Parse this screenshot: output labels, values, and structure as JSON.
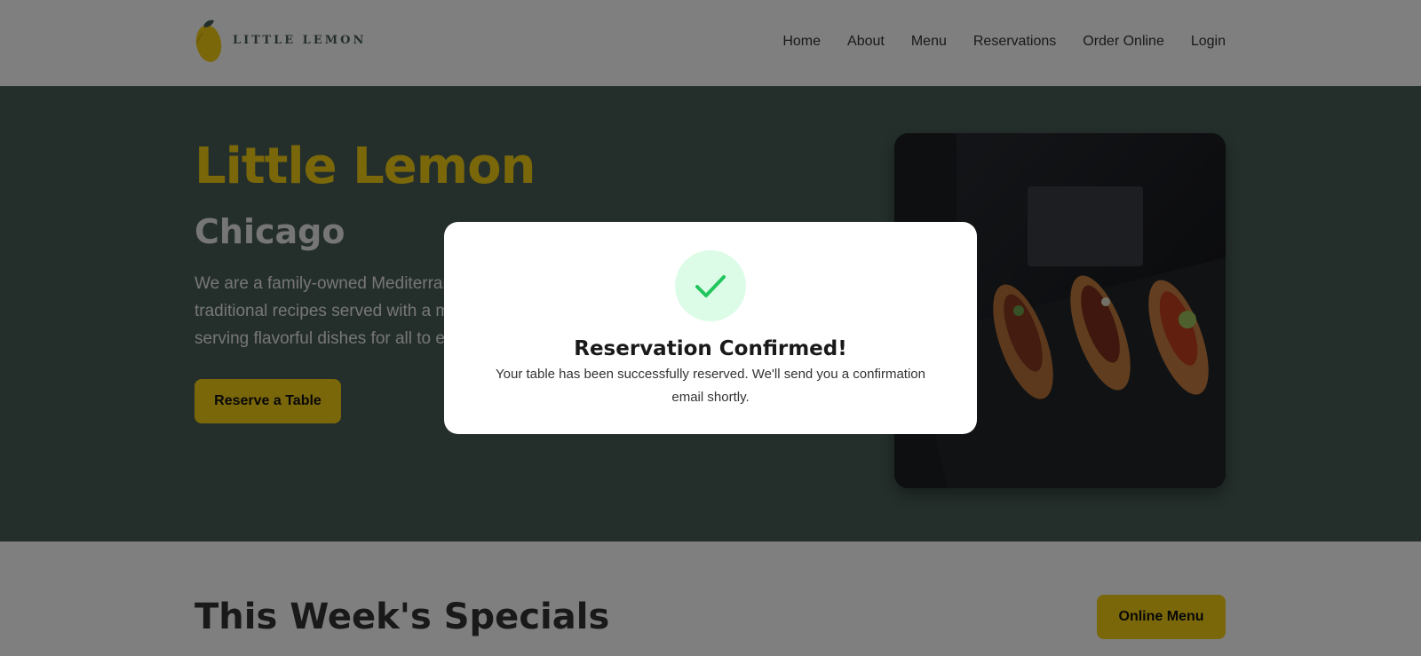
{
  "header": {
    "logo_text": "LITTLE LEMON",
    "nav": [
      "Home",
      "About",
      "Menu",
      "Reservations",
      "Order Online",
      "Login"
    ]
  },
  "hero": {
    "title": "Little Lemon",
    "subtitle": "Chicago",
    "description": "We are a family-owned Mediterranean restaurant, focused on traditional recipes served with a modern twist. We take pride in serving flavorful dishes for all to enjoy.",
    "reserve_label": "Reserve a Table",
    "image_icon": "food-photo"
  },
  "specials": {
    "title": "This Week's Specials",
    "menu_label": "Online Menu"
  },
  "modal": {
    "icon": "check-icon",
    "title": "Reservation Confirmed!",
    "message": "Your table has been successfully reserved. We'll send you a confirmation email shortly."
  },
  "colors": {
    "primary_green": "#495e57",
    "primary_yellow": "#f4ce14",
    "success_green": "#22c55e",
    "success_bg": "#dcfce7"
  }
}
